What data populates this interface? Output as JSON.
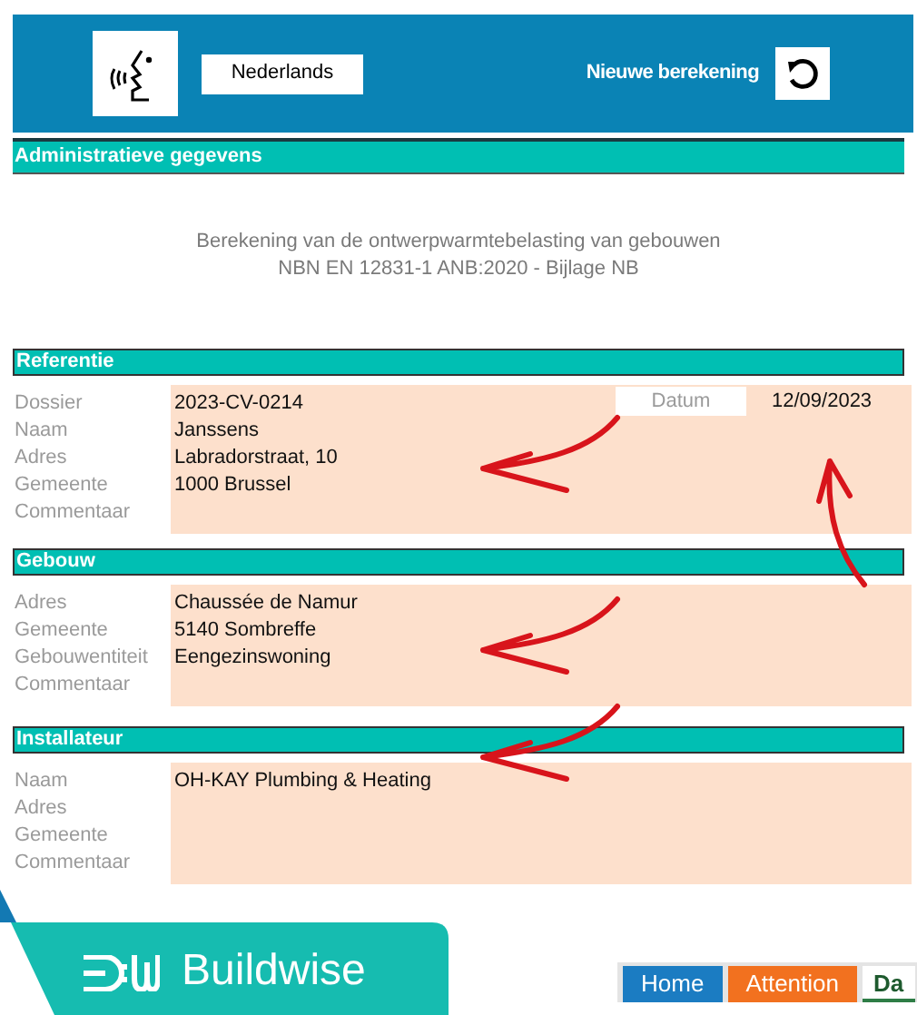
{
  "header": {
    "language": "Nederlands",
    "new_calculation": "Nieuwe berekening"
  },
  "section_bar": "Administratieve gegevens",
  "title": {
    "line1": "Berekening van de ontwerpwarmtebelasting van gebouwen",
    "line2": "NBN EN 12831-1 ANB:2020 - Bijlage NB"
  },
  "sections": [
    {
      "title": "Referentie",
      "date": {
        "label": "Datum",
        "value": "12/09/2023"
      },
      "fields": [
        {
          "label": "Dossier",
          "value": "2023-CV-0214"
        },
        {
          "label": "Naam",
          "value": "Janssens"
        },
        {
          "label": "Adres",
          "value": "Labradorstraat, 10"
        },
        {
          "label": "Gemeente",
          "value": "1000 Brussel"
        },
        {
          "label": "Commentaar"
        }
      ]
    },
    {
      "title": "Gebouw",
      "fields": [
        {
          "label": "Adres",
          "value": "Chaussée de Namur"
        },
        {
          "label": "Gemeente",
          "value": "5140 Sombreffe"
        },
        {
          "label": "Gebouwentiteit",
          "value": "Eengezinswoning"
        },
        {
          "label": "Commentaar"
        }
      ]
    },
    {
      "title": "Installateur",
      "fields": [
        {
          "label": "Naam",
          "value": "OH-KAY Plumbing & Heating"
        },
        {
          "label": "Adres"
        },
        {
          "label": "Gemeente"
        },
        {
          "label": "Commentaar"
        }
      ]
    }
  ],
  "brand": "Buildwise",
  "tabs": [
    {
      "label": "Home",
      "selected": false,
      "color": "#1b7cc2"
    },
    {
      "label": "Attention",
      "selected": false,
      "color": "#f2711f"
    },
    {
      "label": "Da",
      "selected": true,
      "color": "#ffffff"
    }
  ]
}
